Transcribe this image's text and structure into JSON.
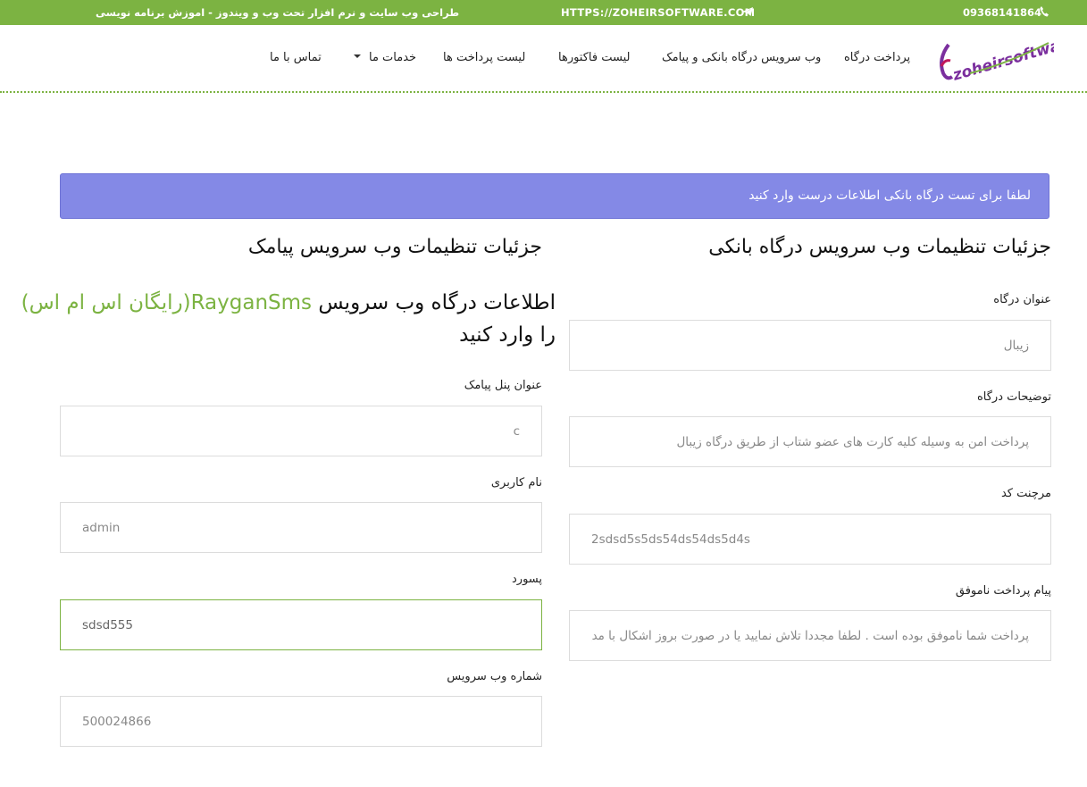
{
  "topbar": {
    "phone": "09368141864",
    "phone_icon": "phone-icon",
    "url": "HTTPS://ZOHEIRSOFTWARE.COM",
    "telegram_icon": "telegram-icon",
    "slogan": "طراحی وب سایت و نرم افزار تحت وب و ویندوز - اموزش برنامه نویسی"
  },
  "brand": {
    "logo_text": "zoheirsoftware",
    "accent": "#7cb342"
  },
  "nav": {
    "items": [
      {
        "label": "پرداخت درگاه"
      },
      {
        "label": "وب سرویس درگاه بانکی و پیامک"
      },
      {
        "label": "لیست فاکتورها"
      },
      {
        "label": "لیست پرداخت ها"
      },
      {
        "label": "خدمات ما"
      },
      {
        "label": "تماس با ما"
      }
    ]
  },
  "alert": {
    "text": "لطفا برای تست درگاه بانکی اطلاعات درست وارد کنید",
    "color": "#8489e6"
  },
  "bank": {
    "heading": "جزئیات تنظیمات وب سرویس درگاه بانکی",
    "fields": [
      {
        "label": "عنوان درگاه",
        "value": "زیبال"
      },
      {
        "label": "توضیحات درگاه",
        "value": "پرداخت امن به وسیله کلیه کارت های عضو شتاب از طریق درگاه زیبال"
      },
      {
        "label": "مرچنت کد",
        "value": "2sdsd5s5ds54ds54ds5d4s"
      },
      {
        "label": "پیام پرداخت ناموفق",
        "value": "پرداخت شما ناموفق بوده است . لطفا مجددا تلاش نمایید یا در صورت بروز اشکال با مدیر سایت تماس بگیرید"
      }
    ]
  },
  "sms": {
    "heading": "جزئیات تنظیمات وب سرویس پیامک",
    "intro_prefix": "اطلاعات درگاه وب سرویس",
    "intro_highlight": "RayganSms(رایگان اس ام اس)",
    "intro_suffix": "را وارد کنید",
    "fields": [
      {
        "label": "عنوان پنل پیامک",
        "value": "c"
      },
      {
        "label": "نام کاربری",
        "value": "admin"
      },
      {
        "label": "پسورد",
        "value": "sdsd555"
      },
      {
        "label": "شماره وب سرویس",
        "value": "500024866"
      }
    ]
  }
}
